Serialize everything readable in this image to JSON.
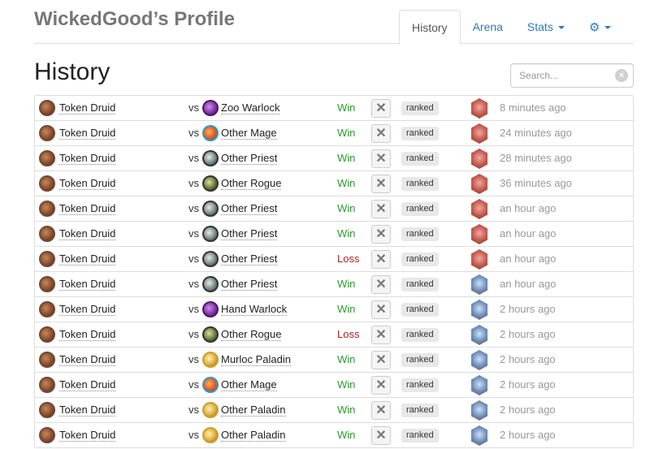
{
  "header": {
    "title": "WickedGood’s Profile",
    "tabs": [
      {
        "label": "History",
        "active": true
      },
      {
        "label": "Arena"
      },
      {
        "label": "Stats"
      }
    ]
  },
  "page": {
    "heading": "History",
    "search_placeholder": "Search..."
  },
  "colors": {
    "win": "#2e9a2e",
    "loss": "#b22222",
    "link": "#2a7bbd",
    "time": "#999999"
  },
  "games": [
    {
      "player_class": "druid",
      "player_deck": "Token Druid",
      "vs": "vs",
      "opponent_class": "warlock",
      "opponent_deck": "Zoo Warlock",
      "result": "Win",
      "mode": "ranked",
      "rank_icon": "red-rank-icon",
      "time": "8 minutes ago"
    },
    {
      "player_class": "druid",
      "player_deck": "Token Druid",
      "vs": "vs",
      "opponent_class": "mage",
      "opponent_deck": "Other Mage",
      "result": "Win",
      "mode": "ranked",
      "rank_icon": "red-rank-icon",
      "time": "24 minutes ago"
    },
    {
      "player_class": "druid",
      "player_deck": "Token Druid",
      "vs": "vs",
      "opponent_class": "priest",
      "opponent_deck": "Other Priest",
      "result": "Win",
      "mode": "ranked",
      "rank_icon": "red-rank-icon",
      "time": "28 minutes ago"
    },
    {
      "player_class": "druid",
      "player_deck": "Token Druid",
      "vs": "vs",
      "opponent_class": "rogue",
      "opponent_deck": "Other Rogue",
      "result": "Win",
      "mode": "ranked",
      "rank_icon": "red-rank-icon",
      "time": "36 minutes ago"
    },
    {
      "player_class": "druid",
      "player_deck": "Token Druid",
      "vs": "vs",
      "opponent_class": "priest",
      "opponent_deck": "Other Priest",
      "result": "Win",
      "mode": "ranked",
      "rank_icon": "red-rank-icon",
      "time": "an hour ago"
    },
    {
      "player_class": "druid",
      "player_deck": "Token Druid",
      "vs": "vs",
      "opponent_class": "priest",
      "opponent_deck": "Other Priest",
      "result": "Win",
      "mode": "ranked",
      "rank_icon": "red-rank-icon",
      "time": "an hour ago"
    },
    {
      "player_class": "druid",
      "player_deck": "Token Druid",
      "vs": "vs",
      "opponent_class": "priest",
      "opponent_deck": "Other Priest",
      "result": "Loss",
      "mode": "ranked",
      "rank_icon": "red-rank-icon",
      "time": "an hour ago"
    },
    {
      "player_class": "druid",
      "player_deck": "Token Druid",
      "vs": "vs",
      "opponent_class": "priest",
      "opponent_deck": "Other Priest",
      "result": "Win",
      "mode": "ranked",
      "rank_icon": "blue-rank-icon",
      "time": "an hour ago"
    },
    {
      "player_class": "druid",
      "player_deck": "Token Druid",
      "vs": "vs",
      "opponent_class": "warlock",
      "opponent_deck": "Hand Warlock",
      "result": "Win",
      "mode": "ranked",
      "rank_icon": "blue-rank-icon",
      "time": "2 hours ago"
    },
    {
      "player_class": "druid",
      "player_deck": "Token Druid",
      "vs": "vs",
      "opponent_class": "rogue",
      "opponent_deck": "Other Rogue",
      "result": "Loss",
      "mode": "ranked",
      "rank_icon": "blue-rank-icon",
      "time": "2 hours ago"
    },
    {
      "player_class": "druid",
      "player_deck": "Token Druid",
      "vs": "vs",
      "opponent_class": "paladin",
      "opponent_deck": "Murloc Paladin",
      "result": "Win",
      "mode": "ranked",
      "rank_icon": "blue-rank-icon",
      "time": "2 hours ago"
    },
    {
      "player_class": "druid",
      "player_deck": "Token Druid",
      "vs": "vs",
      "opponent_class": "mage",
      "opponent_deck": "Other Mage",
      "result": "Win",
      "mode": "ranked",
      "rank_icon": "blue-rank-icon",
      "time": "2 hours ago"
    },
    {
      "player_class": "druid",
      "player_deck": "Token Druid",
      "vs": "vs",
      "opponent_class": "paladin",
      "opponent_deck": "Other Paladin",
      "result": "Win",
      "mode": "ranked",
      "rank_icon": "blue-rank-icon",
      "time": "2 hours ago"
    },
    {
      "player_class": "druid",
      "player_deck": "Token Druid",
      "vs": "vs",
      "opponent_class": "paladin",
      "opponent_deck": "Other Paladin",
      "result": "Win",
      "mode": "ranked",
      "rank_icon": "blue-rank-icon",
      "time": "2 hours ago"
    }
  ]
}
